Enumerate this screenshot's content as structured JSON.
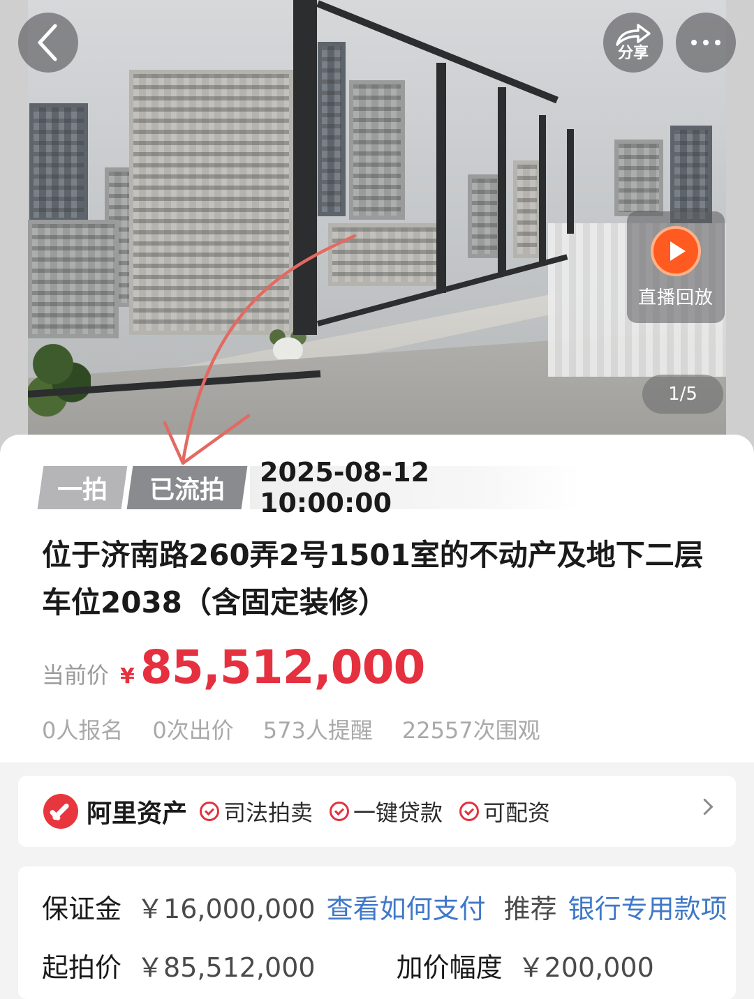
{
  "hero": {
    "share_label": "分享",
    "live_replay_label": "直播回放",
    "image_counter": "1/5"
  },
  "auction": {
    "round_tag": "一拍",
    "status_tag": "已流拍",
    "datetime": "2025-08-12 10:00:00",
    "title": "位于济南路260弄2号1501室的不动产及地下二层车位2038（含固定装修）",
    "price_label": "当前价",
    "currency": "¥",
    "current_price": "85,512,000",
    "stats": {
      "signups": "0人报名",
      "bids": "0次出价",
      "reminders": "573人提醒",
      "views": "22557次围观"
    }
  },
  "badges": {
    "brand": "阿里资产",
    "features": [
      "司法拍卖",
      "一键贷款",
      "可配资"
    ]
  },
  "details": {
    "deposit_label": "保证金",
    "deposit_value": "￥16,000,000",
    "deposit_link": "查看如何支付",
    "recommend_label": "推荐",
    "recommend_link": "银行专用款项",
    "start_price_label": "起拍价",
    "start_price_value": "￥85,512,000",
    "increment_label": "加价幅度",
    "increment_value": "￥200,000"
  },
  "colors": {
    "price_red": "#e5303f",
    "link_blue": "#3f78c9",
    "live_orange": "#ff5a1f",
    "annotation_arrow": "#e26a62"
  }
}
